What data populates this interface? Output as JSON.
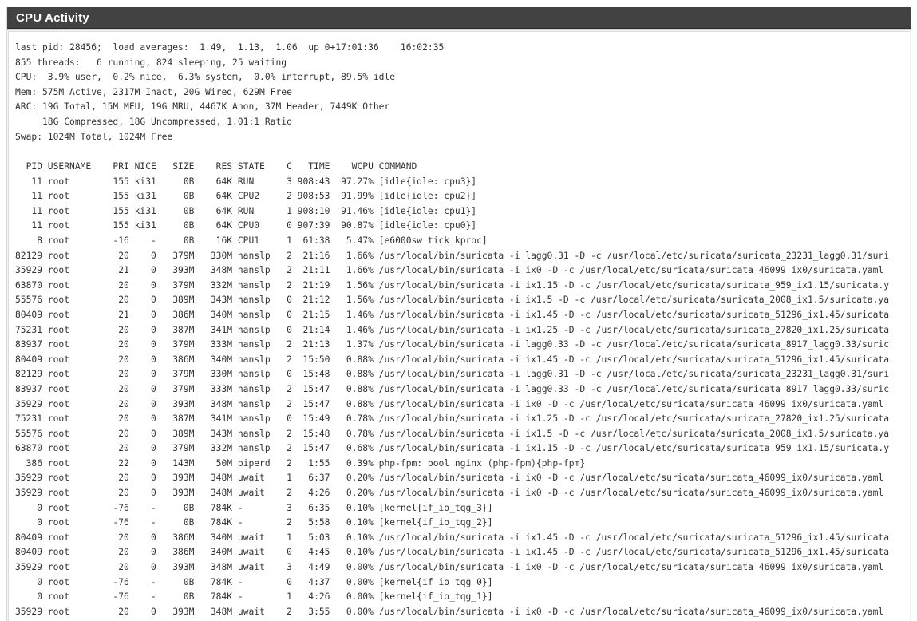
{
  "panel": {
    "title": "CPU Activity"
  },
  "summary_lines": [
    "last pid: 28456;  load averages:  1.49,  1.13,  1.06  up 0+17:01:36    16:02:35",
    "855 threads:   6 running, 824 sleeping, 25 waiting",
    "CPU:  3.9% user,  0.2% nice,  6.3% system,  0.0% interrupt, 89.5% idle",
    "Mem: 575M Active, 2317M Inact, 20G Wired, 629M Free",
    "ARC: 19G Total, 15M MFU, 19G MRU, 4467K Anon, 37M Header, 7449K Other",
    "     18G Compressed, 18G Uncompressed, 1.01:1 Ratio",
    "Swap: 1024M Total, 1024M Free"
  ],
  "process_header": "  PID USERNAME    PRI NICE   SIZE    RES STATE    C   TIME    WCPU COMMAND",
  "process_lines": [
    "   11 root        155 ki31     0B    64K RUN      3 908:43  97.27% [idle{idle: cpu3}]",
    "   11 root        155 ki31     0B    64K CPU2     2 908:53  91.99% [idle{idle: cpu2}]",
    "   11 root        155 ki31     0B    64K RUN      1 908:10  91.46% [idle{idle: cpu1}]",
    "   11 root        155 ki31     0B    64K CPU0     0 907:39  90.87% [idle{idle: cpu0}]",
    "    8 root        -16    -     0B    16K CPU1     1  61:38   5.47% [e6000sw tick kproc]",
    "82129 root         20    0   379M   330M nanslp   2  21:16   1.66% /usr/local/bin/suricata -i lagg0.31 -D -c /usr/local/etc/suricata/suricata_23231_lagg0.31/suri",
    "35929 root         21    0   393M   348M nanslp   2  21:11   1.66% /usr/local/bin/suricata -i ix0 -D -c /usr/local/etc/suricata/suricata_46099_ix0/suricata.yaml",
    "63870 root         20    0   379M   332M nanslp   2  21:19   1.56% /usr/local/bin/suricata -i ix1.15 -D -c /usr/local/etc/suricata/suricata_959_ix1.15/suricata.y",
    "55576 root         20    0   389M   343M nanslp   0  21:12   1.56% /usr/local/bin/suricata -i ix1.5 -D -c /usr/local/etc/suricata/suricata_2008_ix1.5/suricata.ya",
    "80409 root         21    0   386M   340M nanslp   0  21:15   1.46% /usr/local/bin/suricata -i ix1.45 -D -c /usr/local/etc/suricata/suricata_51296_ix1.45/suricata",
    "75231 root         20    0   387M   341M nanslp   0  21:14   1.46% /usr/local/bin/suricata -i ix1.25 -D -c /usr/local/etc/suricata/suricata_27820_ix1.25/suricata",
    "83937 root         20    0   379M   333M nanslp   2  21:13   1.37% /usr/local/bin/suricata -i lagg0.33 -D -c /usr/local/etc/suricata/suricata_8917_lagg0.33/suric",
    "80409 root         20    0   386M   340M nanslp   2  15:50   0.88% /usr/local/bin/suricata -i ix1.45 -D -c /usr/local/etc/suricata/suricata_51296_ix1.45/suricata",
    "82129 root         20    0   379M   330M nanslp   0  15:48   0.88% /usr/local/bin/suricata -i lagg0.31 -D -c /usr/local/etc/suricata/suricata_23231_lagg0.31/suri",
    "83937 root         20    0   379M   333M nanslp   2  15:47   0.88% /usr/local/bin/suricata -i lagg0.33 -D -c /usr/local/etc/suricata/suricata_8917_lagg0.33/suric",
    "35929 root         20    0   393M   348M nanslp   2  15:47   0.88% /usr/local/bin/suricata -i ix0 -D -c /usr/local/etc/suricata/suricata_46099_ix0/suricata.yaml",
    "75231 root         20    0   387M   341M nanslp   0  15:49   0.78% /usr/local/bin/suricata -i ix1.25 -D -c /usr/local/etc/suricata/suricata_27820_ix1.25/suricata",
    "55576 root         20    0   389M   343M nanslp   2  15:48   0.78% /usr/local/bin/suricata -i ix1.5 -D -c /usr/local/etc/suricata/suricata_2008_ix1.5/suricata.ya",
    "63870 root         20    0   379M   332M nanslp   2  15:47   0.68% /usr/local/bin/suricata -i ix1.15 -D -c /usr/local/etc/suricata/suricata_959_ix1.15/suricata.y",
    "  386 root         22    0   143M    50M piperd   2   1:55   0.39% php-fpm: pool nginx (php-fpm){php-fpm}",
    "35929 root         20    0   393M   348M uwait    1   6:37   0.20% /usr/local/bin/suricata -i ix0 -D -c /usr/local/etc/suricata/suricata_46099_ix0/suricata.yaml",
    "35929 root         20    0   393M   348M uwait    2   4:26   0.20% /usr/local/bin/suricata -i ix0 -D -c /usr/local/etc/suricata/suricata_46099_ix0/suricata.yaml",
    "    0 root        -76    -     0B   784K -        3   6:35   0.10% [kernel{if_io_tqg_3}]",
    "    0 root        -76    -     0B   784K -        2   5:58   0.10% [kernel{if_io_tqg_2}]",
    "80409 root         20    0   386M   340M uwait    1   5:03   0.10% /usr/local/bin/suricata -i ix1.45 -D -c /usr/local/etc/suricata/suricata_51296_ix1.45/suricata",
    "80409 root         20    0   386M   340M uwait    0   4:45   0.10% /usr/local/bin/suricata -i ix1.45 -D -c /usr/local/etc/suricata/suricata_51296_ix1.45/suricata",
    "35929 root         20    0   393M   348M uwait    3   4:49   0.00% /usr/local/bin/suricata -i ix0 -D -c /usr/local/etc/suricata/suricata_46099_ix0/suricata.yaml",
    "    0 root        -76    -     0B   784K -        0   4:37   0.00% [kernel{if_io_tqg_0}]",
    "    0 root        -76    -     0B   784K -        1   4:26   0.00% [kernel{if_io_tqg_1}]",
    "35929 root         20    0   393M   348M uwait    2   3:55   0.00% /usr/local/bin/suricata -i ix0 -D -c /usr/local/etc/suricata/suricata_46099_ix0/suricata.yaml"
  ]
}
